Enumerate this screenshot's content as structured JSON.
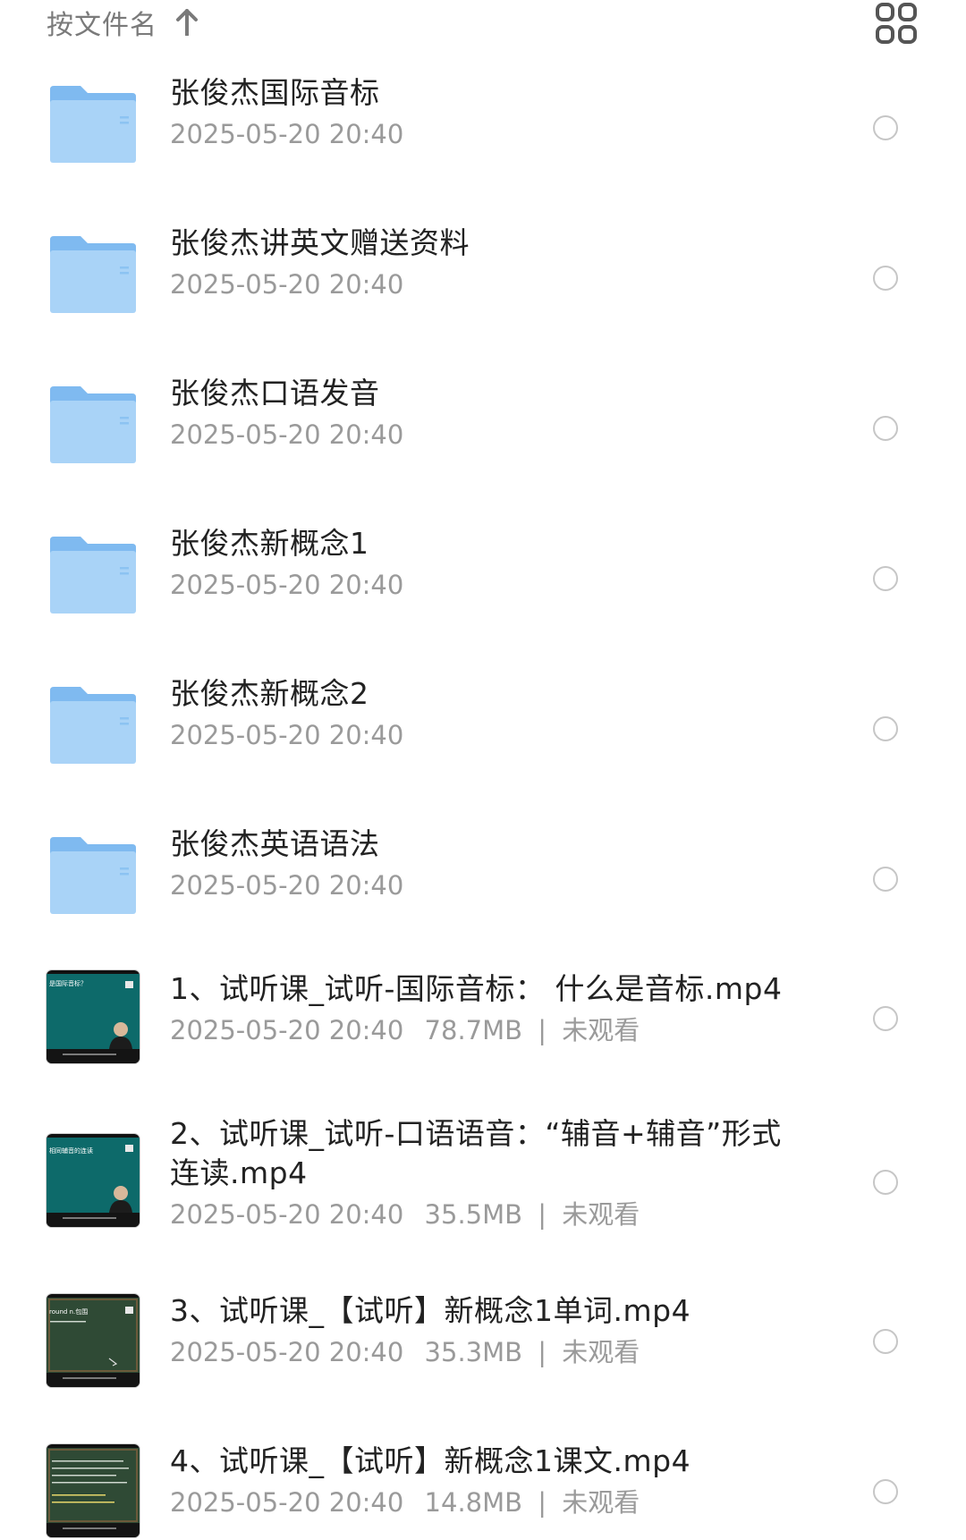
{
  "toolbar": {
    "sort_label": "按文件名",
    "sort_icon": "arrow-up-icon",
    "view_toggle_icon": "grid-view-icon"
  },
  "colors": {
    "folder_light": "#a9d3f7",
    "folder_dark": "#7fbaf0",
    "meta_text": "#9a9a9a",
    "name_text": "#222222",
    "circle_border": "#c6c6c6"
  },
  "folders": [
    {
      "name": "张俊杰国际音标",
      "date": "2025-05-20 20:40"
    },
    {
      "name": "张俊杰讲英文赠送资料",
      "date": "2025-05-20 20:40"
    },
    {
      "name": "张俊杰口语发音",
      "date": "2025-05-20 20:40"
    },
    {
      "name": "张俊杰新概念1",
      "date": "2025-05-20 20:40"
    },
    {
      "name": "张俊杰新概念2",
      "date": "2025-05-20 20:40"
    },
    {
      "name": "张俊杰英语语法",
      "date": "2025-05-20 20:40"
    }
  ],
  "videos": [
    {
      "name": "1、试听课_试听-国际音标： 什么是音标.mp4",
      "date": "2025-05-20 20:40",
      "size": "78.7MB",
      "status": "未观看",
      "thumb_caption": "是国际音标？"
    },
    {
      "name": "2、试听课_试听-口语语音：“辅音+辅音”形式连读.mp4",
      "date": "2025-05-20 20:40",
      "size": "35.5MB",
      "status": "未观看",
      "thumb_caption": "相同辅音的连读"
    },
    {
      "name": "3、试听课_【试听】新概念1单词.mp4",
      "date": "2025-05-20 20:40",
      "size": "35.3MB",
      "status": "未观看",
      "thumb_caption": "round n.包围"
    },
    {
      "name": "4、试听课_【试听】新概念1课文.mp4",
      "date": "2025-05-20 20:40",
      "size": "14.8MB",
      "status": "未观看",
      "thumb_caption": ""
    }
  ]
}
